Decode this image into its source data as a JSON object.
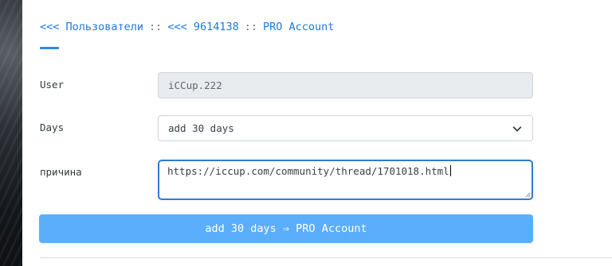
{
  "nav": {
    "crumb_users": "<<< Пользователи",
    "sep1": "::",
    "crumb_user_id": "<<< 9614138",
    "sep2": "::",
    "current": "PRO Account"
  },
  "form": {
    "user_label": "User",
    "user_value": "iCCup.222",
    "days_label": "Days",
    "days_selected": "add 30 days",
    "reason_label": "причина",
    "reason_value": "https://iccup.com/community/thread/1701018.html",
    "submit_label": "add 30 days ⇒ PRO Account"
  },
  "colors": {
    "accent": "#1e78d8",
    "button": "#5aaefc",
    "focus_border": "#2f7ad3"
  },
  "icons": {
    "days_select": "chevron-down-icon",
    "reason_resize": "resize-handle-icon"
  }
}
